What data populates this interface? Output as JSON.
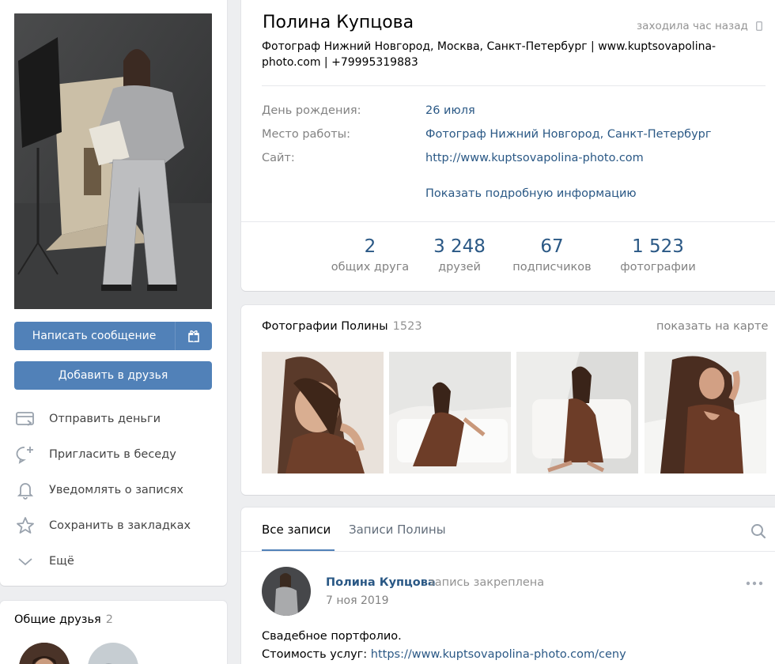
{
  "colors": {
    "accent": "#5181b8",
    "link": "#2a5885",
    "muted": "#828282",
    "background": "#edeef0"
  },
  "sidebar": {
    "message_button": "Написать сообщение",
    "gift_icon": "gift-icon",
    "add_friend_button": "Добавить в друзья",
    "actions": [
      {
        "label": "Отправить деньги",
        "icon": "card-send-icon"
      },
      {
        "label": "Пригласить в беседу",
        "icon": "chat-add-icon"
      },
      {
        "label": "Уведомлять о записях",
        "icon": "bell-icon"
      },
      {
        "label": "Сохранить в закладках",
        "icon": "star-icon"
      },
      {
        "label": "Ещё",
        "icon": "chevron-down-icon"
      }
    ]
  },
  "friends": {
    "title": "Общие друзья",
    "count": "2"
  },
  "profile": {
    "name": "Полина Купцова",
    "last_seen": "заходила час назад",
    "status_line1": "Фотограф Нижний Новгород, Москва, Санкт-Петербург | www.kuptsovapolina-",
    "status_line2": "photo.com | +79995319883",
    "info": [
      {
        "key": "День рождения:",
        "value": "26 июля"
      },
      {
        "key": "Место работы:",
        "value": "Фотограф Нижний Новгород, Санкт-Петербург"
      },
      {
        "key": "Сайт:",
        "value": "http://www.kuptsovapolina-photo.com"
      }
    ],
    "show_more": "Показать подробную информацию",
    "counters": [
      {
        "num": "2",
        "label": "общих друга"
      },
      {
        "num": "3 248",
        "label": "друзей"
      },
      {
        "num": "67",
        "label": "подписчиков"
      },
      {
        "num": "1 523",
        "label": "фотографии"
      }
    ]
  },
  "photos": {
    "title": "Фотографии Полины",
    "count": "1523",
    "map_link": "показать на карте"
  },
  "wall": {
    "tabs": [
      "Все записи",
      "Записи Полины"
    ],
    "post": {
      "author": "Полина Купцова",
      "pinned": "запись закреплена",
      "date": "7 ноя 2019",
      "text_line1": "Свадебное портфолио.",
      "text_line2_prefix": "Стоимость услуг: ",
      "text_link": "https://www.kuptsovapolina-photo.com/ceny"
    }
  }
}
